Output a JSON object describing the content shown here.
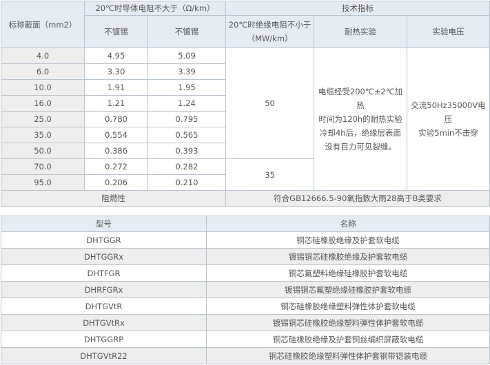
{
  "spec": {
    "col_section": "标称截面（mm2）",
    "conductor_group": "20℃时导体电阻不大于（Ω/km）",
    "tech_group": "技术指标",
    "col_unplated": "不镀锡",
    "col_unplated2": "不镀锡",
    "col_insulation_line1": "20℃时绝缘电阻不小于",
    "col_insulation_line2": "（MW/km）",
    "col_heat": "耐热实验",
    "col_voltage": "实验电压",
    "rows": [
      {
        "section": "4.0",
        "r1": "4.95",
        "r2": "5.09"
      },
      {
        "section": "6.0",
        "r1": "3.30",
        "r2": "3.39"
      },
      {
        "section": "10.0",
        "r1": "1.91",
        "r2": "1.95"
      },
      {
        "section": "16.0",
        "r1": "1.21",
        "r2": "1.24"
      },
      {
        "section": "25.0",
        "r1": "0.780",
        "r2": "0.795"
      },
      {
        "section": "35.0",
        "r1": "0.554",
        "r2": "0.565"
      },
      {
        "section": "50.0",
        "r1": "0.386",
        "r2": "0.393"
      },
      {
        "section": "70.0",
        "r1": "0.272",
        "r2": "0.282"
      },
      {
        "section": "95.0",
        "r1": "0.206",
        "r2": "0.210"
      }
    ],
    "insulation_a": "50",
    "insulation_b": "35",
    "heat_line1": "电缆经受200℃±2℃加热",
    "heat_line2": "时间为120h的耐热实验",
    "heat_line3": "冷却4h后，绝缘层表面",
    "heat_line4": "没有目力可见裂缝。",
    "voltage_line1": "交流50Hz35000V电压",
    "voltage_line2": "实验5min不击穿",
    "flame_label": "阻燃性",
    "flame_value": "符合GB12666.5-90氧指数大雨28高于B类要求"
  },
  "models": {
    "col_model": "型号",
    "col_name": "名称",
    "rows": [
      {
        "model": "DHTGGR",
        "name": "铜芯硅橡胶绝缘及护套软电缆"
      },
      {
        "model": "DHTGGRx",
        "name": "镀锡铜芯硅橡胶绝缘及护套软电缆"
      },
      {
        "model": "DHTFGR",
        "name": "铜芯氟塑料绝缘硅橡胶护套软电缆"
      },
      {
        "model": "DHRFGRx",
        "name": "镀锡铜芯氟塑绝缘硅橡胶护套软电缆"
      },
      {
        "model": "DHTGVtR",
        "name": "铜芯硅橡胶绝缘塑料弹性体护套软电缆"
      },
      {
        "model": "DHTGVtRx",
        "name": "镀锡铜芯硅橡胶绝缘塑料弹性体护套软电缆"
      },
      {
        "model": "DHTGGRP",
        "name": "铜芯硅橡胶绝缘及护套铜丝编织屏蔽软电缆"
      },
      {
        "model": "DHTGVtR22",
        "name": "铜芯硅橡胶绝缘塑料弹性体护套钢带铠装电缆"
      }
    ]
  }
}
